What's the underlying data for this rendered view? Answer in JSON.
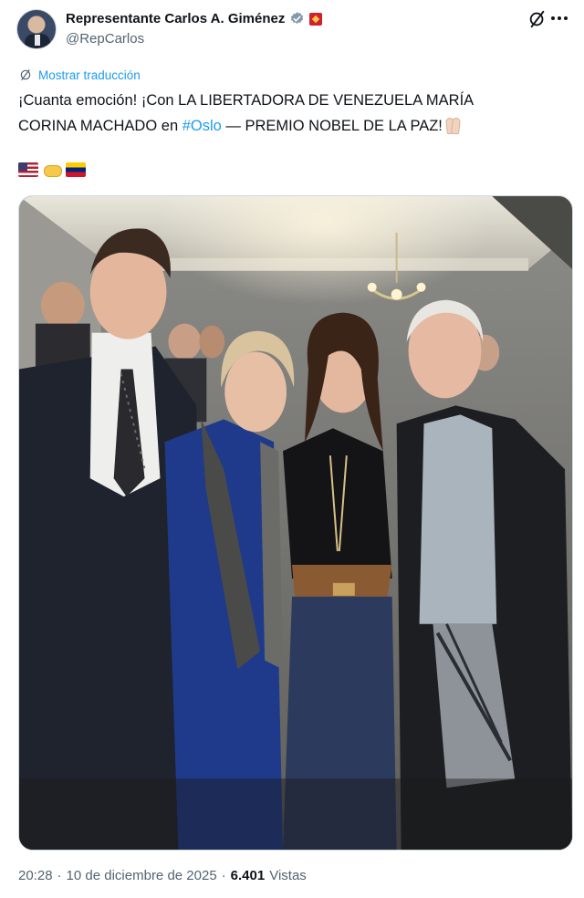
{
  "author": {
    "display_name": "Representante Carlos A. Giménez",
    "handle": "@RepCarlos",
    "verified_icon": "verified-badge-icon",
    "affiliation_icon": "flag-badge-icon",
    "avatar": "avatar"
  },
  "tweet": {
    "translate_label": "Mostrar traducción",
    "text_part1": "¡Cuanta emoción! ¡Con LA LIBERTADORA DE VENEZUELA MARÍA CORINA MACHADO en ",
    "hashtag": "#Oslo",
    "text_part2": " — PREMIO NOBEL DE LA PAZ!",
    "emojis": [
      "us-flag-emoji",
      "handshake-emoji",
      "venezuela-flag-emoji"
    ]
  },
  "meta": {
    "time": "20:28",
    "separator1": "·",
    "date": "10 de diciembre de 2025",
    "separator2": "·",
    "views_count": "6.401",
    "views_label": "Vistas"
  },
  "colors": {
    "accent": "#1d9bf0",
    "text": "#0f1419",
    "secondary": "#536471"
  }
}
